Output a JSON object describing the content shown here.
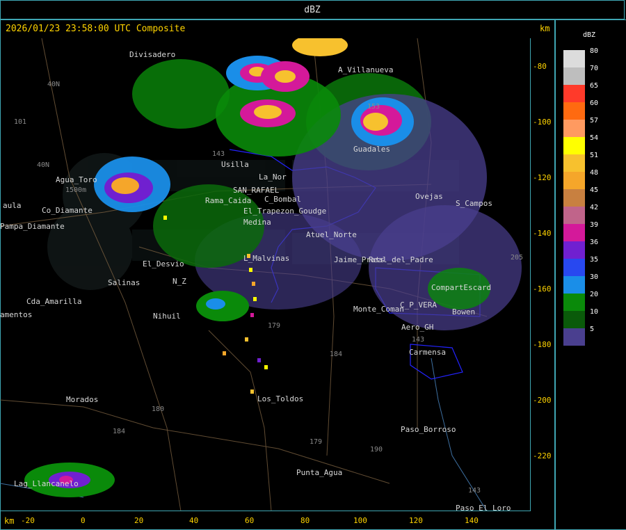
{
  "header": {
    "title": "dBZ"
  },
  "map": {
    "timestamp": "2026/01/23 23:58:00 UTC Composite",
    "km_label_top": "km",
    "km_label_bottom": "km",
    "y_ticks": [
      "-80",
      "-100",
      "-120",
      "-140",
      "-160",
      "-180",
      "-200",
      "-220"
    ],
    "x_ticks": [
      "-20",
      "0",
      "20",
      "40",
      "60",
      "80",
      "100",
      "120",
      "140"
    ],
    "places": [
      "Divisadero",
      "A_Villanueva",
      "Agua_Toro",
      "Pampa_Diamante",
      "Co_Diamante",
      "Usilla",
      "La_Nor",
      "SAN_RAFAEL",
      "C_Bombal",
      "El_Trapezon_Goudge",
      "El_Desvio",
      "Salinas",
      "Cda_Amarilla",
      "Nihuil",
      "L_Malvinas",
      "Medina",
      "Ovejas",
      "S_Campos",
      "CompartEscard",
      "C_P_VERA",
      "Bowen",
      "Aero_GH",
      "Carmensa",
      "Morados",
      "Los_Toldos",
      "Paso_Borroso",
      "Punta_Agua",
      "Lag_Llancanelo",
      "Paso_El_Loro",
      "Guadales",
      "Monte_Coman",
      "Atuel_Norte",
      "Real_del_Padre",
      "N_Z",
      "Rama_Caida",
      "Jaime_Prats",
      "aula",
      "amentos"
    ],
    "routes": [
      "40N",
      "101",
      "40N",
      "143",
      "179",
      "184",
      "180",
      "184",
      "179",
      "190",
      "143",
      "143",
      "205",
      "153",
      "1500m"
    ],
    "features": [
      "radar-echoes",
      "department-borders",
      "roads",
      "rivers",
      "watermark-logo"
    ],
    "colors": {
      "background": "#000000",
      "frame": "#3fa7b4",
      "label_text": "#ffd400",
      "border": "#2323ff"
    }
  },
  "legend": {
    "title": "dBZ",
    "entries": [
      {
        "label": "80",
        "color": "#dcdcdc"
      },
      {
        "label": "70",
        "color": "#bebebe"
      },
      {
        "label": "65",
        "color": "#ff3a2a"
      },
      {
        "label": "60",
        "color": "#ff6a10"
      },
      {
        "label": "57",
        "color": "#ff9a60"
      },
      {
        "label": "54",
        "color": "#ffff00"
      },
      {
        "label": "51",
        "color": "#f7c12e"
      },
      {
        "label": "48",
        "color": "#f5a62a"
      },
      {
        "label": "45",
        "color": "#c88040"
      },
      {
        "label": "42",
        "color": "#c0648a"
      },
      {
        "label": "39",
        "color": "#d4199a"
      },
      {
        "label": "36",
        "color": "#7020d0"
      },
      {
        "label": "35",
        "color": "#2848f0"
      },
      {
        "label": "30",
        "color": "#1a8ee8"
      },
      {
        "label": "20",
        "color": "#0a8a0a"
      },
      {
        "label": "10",
        "color": "#0a5a0a"
      },
      {
        "label": "5",
        "color": "#4a3f8f"
      }
    ]
  }
}
